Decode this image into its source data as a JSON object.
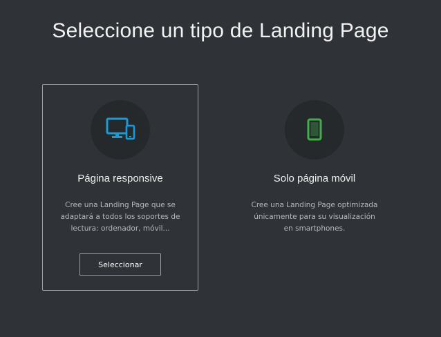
{
  "page": {
    "title": "Seleccione un tipo de Landing Page"
  },
  "options": [
    {
      "title": "Página responsive",
      "description": "Cree una Landing Page que se adaptará a todos los soportes de lectura: ordenador, móvil...",
      "button_label": "Seleccionar",
      "icon": "devices-icon",
      "icon_color": "#1a9ad6"
    },
    {
      "title": "Solo página móvil",
      "description": "Cree una Landing Page optimizada únicamente para su visualización en smartphones.",
      "icon": "smartphone-icon",
      "icon_color": "#3fae49"
    }
  ],
  "colors": {
    "background": "#2f3337",
    "icon_circle": "#26292c",
    "selected_border": "#9aa0a5"
  }
}
